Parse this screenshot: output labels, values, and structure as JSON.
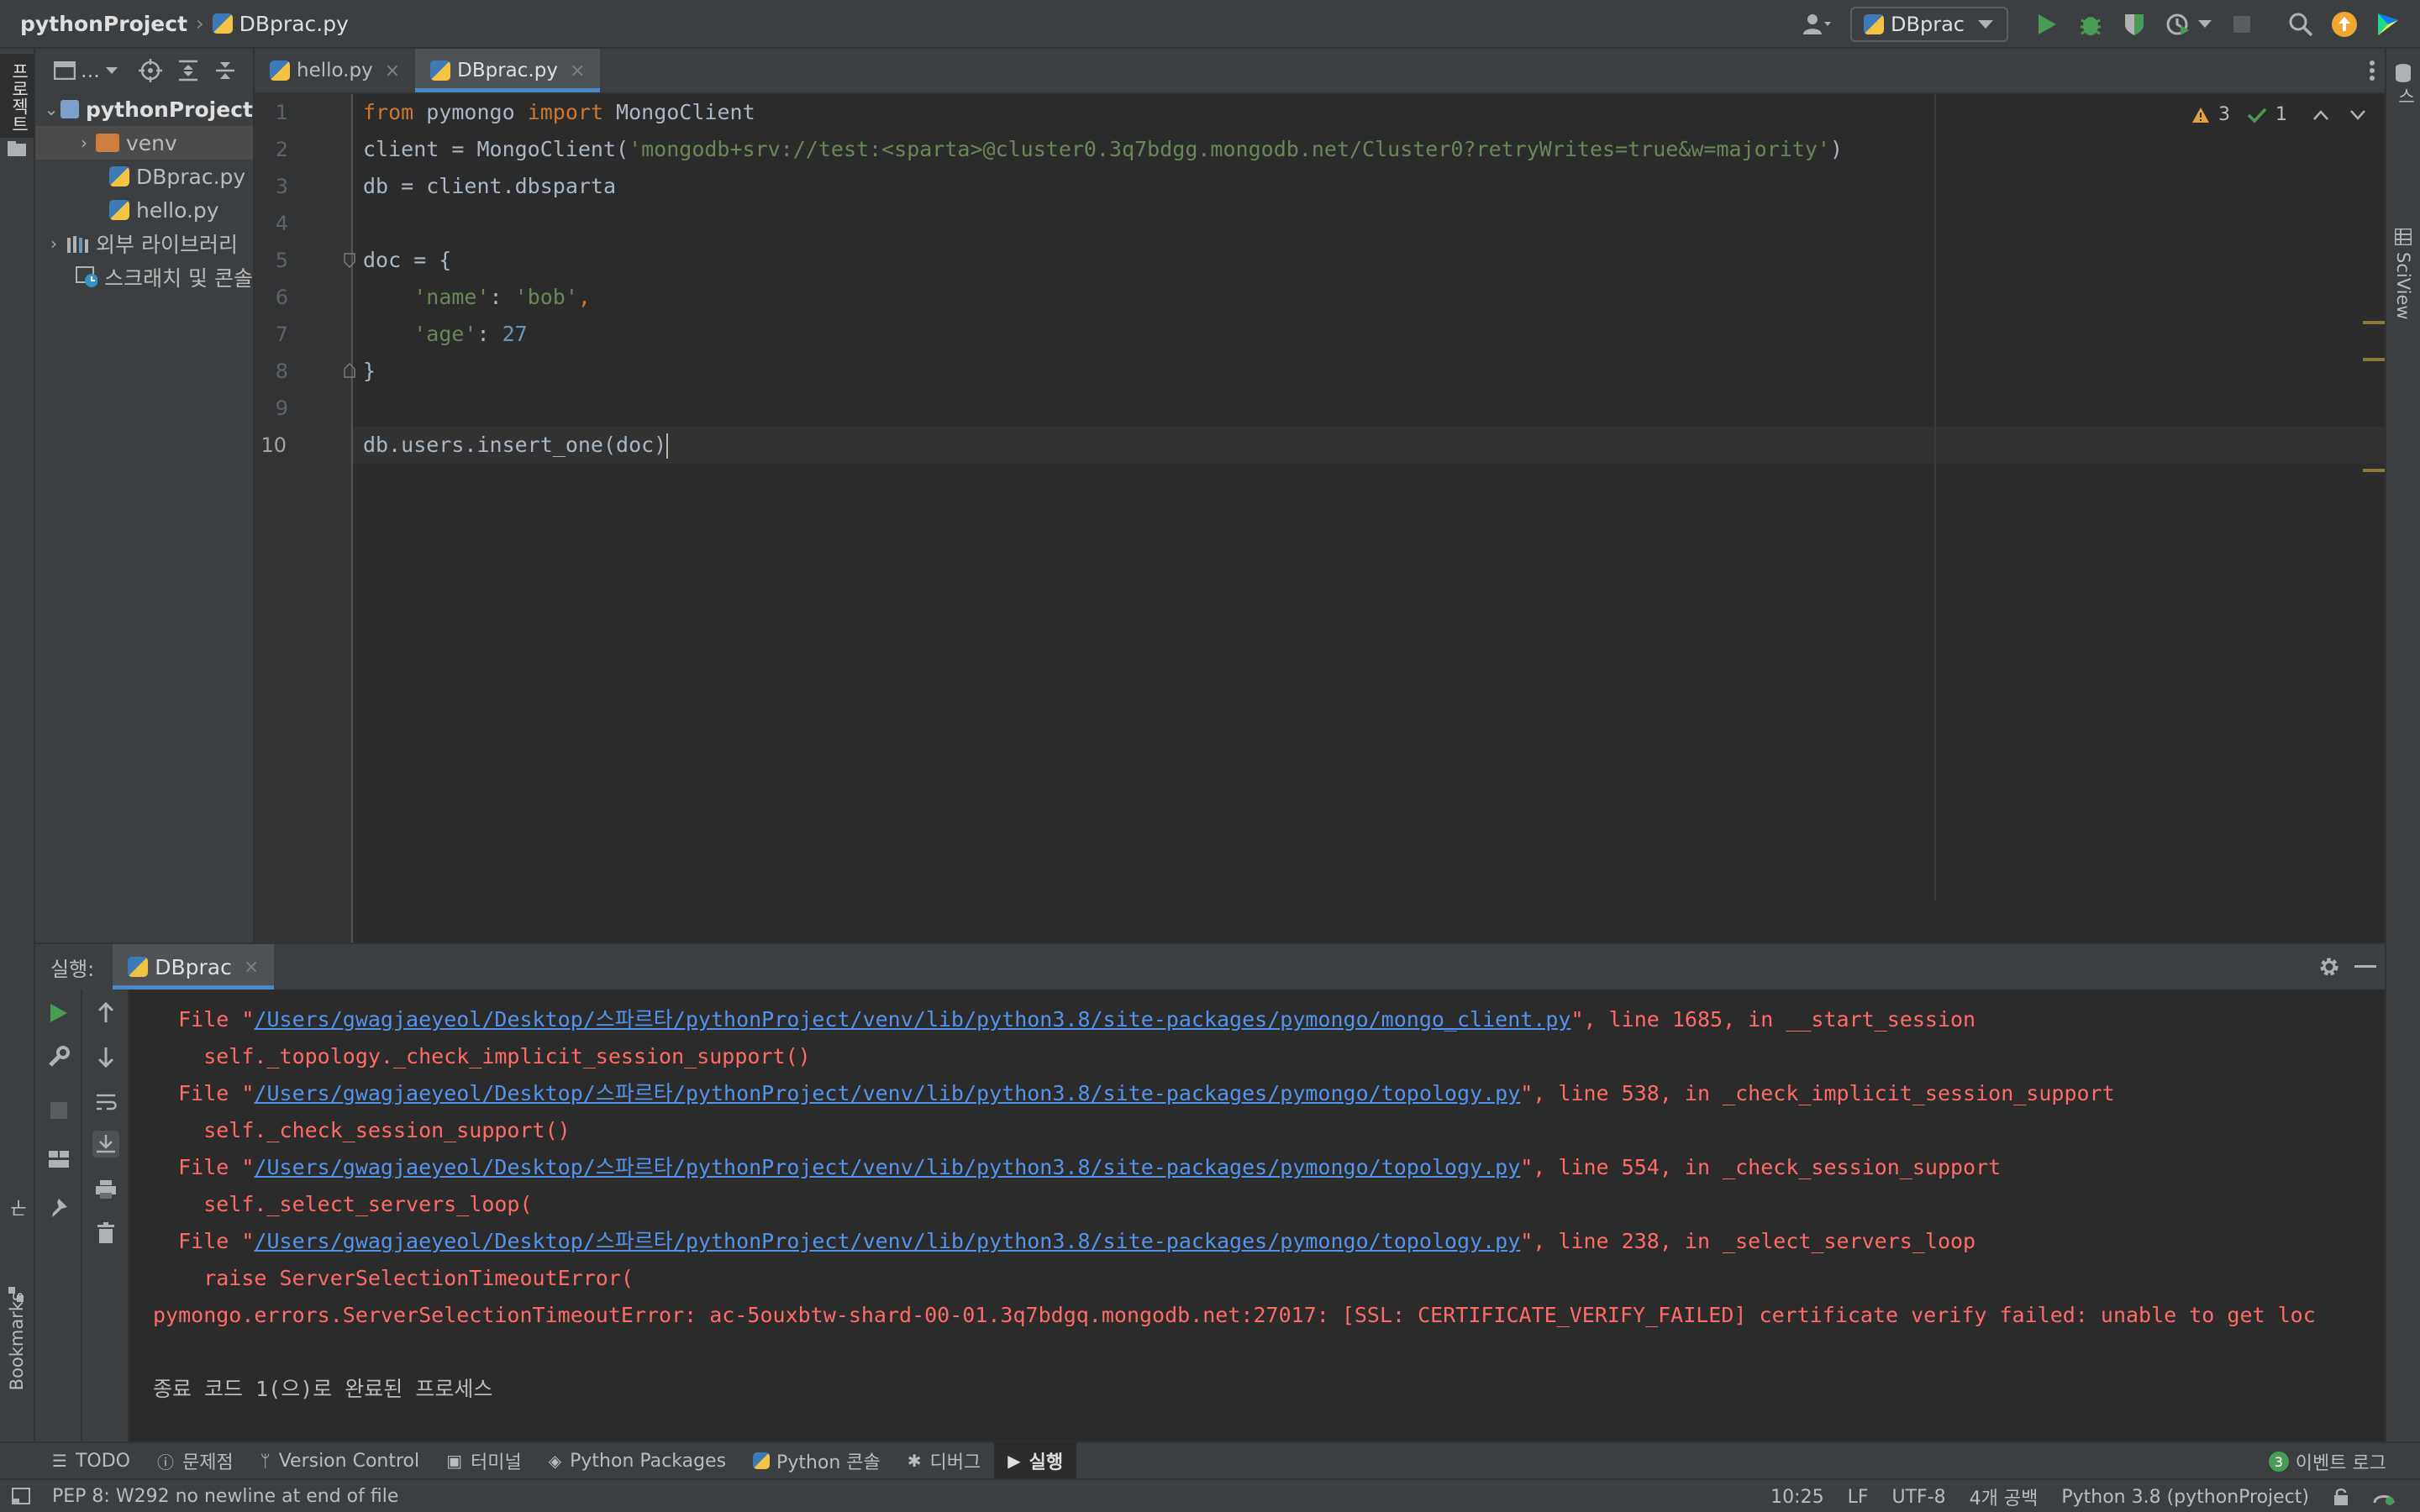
{
  "navbar": {
    "project": "pythonProject",
    "file": "DBprac.py",
    "run_config": "DBprac"
  },
  "left_stripe": {
    "project_label": "프로젝트",
    "structure_label": "구조",
    "bookmarks_label": "Bookmarks"
  },
  "right_stripe": {
    "database_label": "데이터베이스",
    "sciview_label": "SciView"
  },
  "project_panel": {
    "toolbar_label": "...",
    "tree": [
      {
        "label": "pythonProject",
        "type": "root"
      },
      {
        "label": "venv",
        "type": "folder"
      },
      {
        "label": "DBprac.py",
        "type": "file"
      },
      {
        "label": "hello.py",
        "type": "file"
      },
      {
        "label": "외부 라이브러리",
        "type": "libraries"
      },
      {
        "label": "스크래치 및 콘솔",
        "type": "scratch"
      }
    ]
  },
  "editor_tabs": [
    {
      "label": "hello.py",
      "active": false
    },
    {
      "label": "DBprac.py",
      "active": true
    }
  ],
  "inspection": {
    "warnings": "3",
    "ok": "1"
  },
  "editor": {
    "line_numbers": [
      "1",
      "2",
      "3",
      "4",
      "5",
      "6",
      "7",
      "8",
      "9",
      "10"
    ],
    "lines": {
      "l1_from": "from",
      "l1_mod": " pymongo ",
      "l1_import": "import",
      "l1_rest": " MongoClient",
      "l2_pre": "client = MongoClient(",
      "l2_str": "'mongodb+srv://test:<sparta>@cluster0.3q7bdgg.mongodb.net/Cluster0?retryWrites=true&w=majority'",
      "l2_post": ")",
      "l3": "db = client.dbsparta",
      "l5": "doc = {",
      "l6_str1": "'name'",
      "l6_mid": ": ",
      "l6_str2": "'bob'",
      "l6_end": ",",
      "l7_str": "'age'",
      "l7_mid": ": ",
      "l7_num": "27",
      "l8": "}",
      "l10": "db.users.insert_one(doc)"
    }
  },
  "run_panel": {
    "label": "실행:",
    "tab": "DBprac",
    "console": [
      {
        "pre": "  File \"",
        "link": "/Users/gwagjaeyeol/Desktop/스파르타/pythonProject/venv/lib/python3.8/site-packages/pymongo/mongo_client.py",
        "post": "\", line 1685, in __start_session"
      },
      {
        "text": "    self._topology._check_implicit_session_support()"
      },
      {
        "pre": "  File \"",
        "link": "/Users/gwagjaeyeol/Desktop/스파르타/pythonProject/venv/lib/python3.8/site-packages/pymongo/topology.py",
        "post": "\", line 538, in _check_implicit_session_support"
      },
      {
        "text": "    self._check_session_support()"
      },
      {
        "pre": "  File \"",
        "link": "/Users/gwagjaeyeol/Desktop/스파르타/pythonProject/venv/lib/python3.8/site-packages/pymongo/topology.py",
        "post": "\", line 554, in _check_session_support"
      },
      {
        "text": "    self._select_servers_loop("
      },
      {
        "pre": "  File \"",
        "link": "/Users/gwagjaeyeol/Desktop/스파르타/pythonProject/venv/lib/python3.8/site-packages/pymongo/topology.py",
        "post": "\", line 238, in _select_servers_loop"
      },
      {
        "text": "    raise ServerSelectionTimeoutError("
      },
      {
        "text": "pymongo.errors.ServerSelectionTimeoutError: ac-5ouxbtw-shard-00-01.3q7bdgq.mongodb.net:27017: [SSL: CERTIFICATE_VERIFY_FAILED] certificate verify failed: unable to get loc"
      },
      {
        "text": ""
      },
      {
        "text": "종료 코드 1(으)로 완료된 프로세스"
      }
    ]
  },
  "tool_windows": [
    {
      "label": "TODO",
      "icon": "list-icon",
      "active": false
    },
    {
      "label": "문제점",
      "icon": "problems-icon",
      "active": false
    },
    {
      "label": "Version Control",
      "icon": "branch-icon",
      "active": false
    },
    {
      "label": "터미널",
      "icon": "terminal-icon",
      "active": false
    },
    {
      "label": "Python Packages",
      "icon": "layers-icon",
      "active": false
    },
    {
      "label": "Python 콘솔",
      "icon": "python-icon",
      "active": false
    },
    {
      "label": "디버그",
      "icon": "bug-icon",
      "active": false
    },
    {
      "label": "실행",
      "icon": "play-icon",
      "active": true
    }
  ],
  "event_log": {
    "count": "3",
    "label": "이벤트 로그"
  },
  "status_bar": {
    "message": "PEP 8: W292 no newline at end of file",
    "position": "10:25",
    "line_sep": "LF",
    "encoding": "UTF-8",
    "indent": "4개 공백",
    "interpreter": "Python 3.8 (pythonProject)"
  }
}
